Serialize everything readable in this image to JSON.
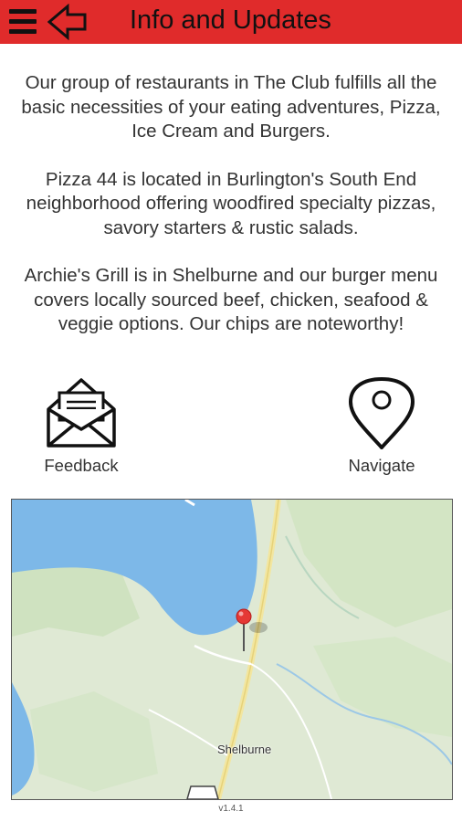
{
  "header": {
    "title": "Info and Updates",
    "menu_icon": "hamburger-menu-icon",
    "back_icon": "arrow-left-icon",
    "background_color": "#e02b2b"
  },
  "info": {
    "paragraphs": [
      "Our group of restaurants in The Club fulfills all the basic necessities of your eating adventures, Pizza, Ice Cream and Burgers.",
      "Pizza 44 is located in Burlington's South End neighborhood offering woodfired specialty pizzas, savory starters & rustic salads.",
      "Archie's Grill is in Shelburne and our burger menu covers locally sourced beef, chicken, seafood & veggie options. Our chips are noteworthy!"
    ]
  },
  "actions": {
    "feedback": {
      "label": "Feedback",
      "icon": "envelope-icon"
    },
    "navigate": {
      "label": "Navigate",
      "icon": "map-pin-icon"
    }
  },
  "map": {
    "place_label": "Shelburne",
    "marker_color": "#e53935",
    "water_color": "#7db8e8",
    "land_color": "#dfe9d4"
  },
  "footer": {
    "version": "v1.4.1"
  }
}
